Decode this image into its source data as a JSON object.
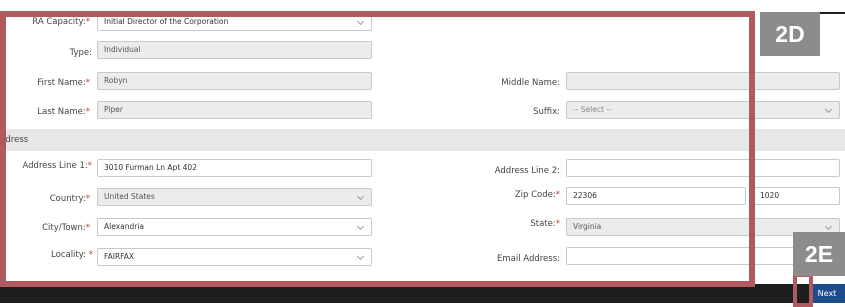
{
  "form": {
    "ra_capacity": {
      "label": "RA Capacity:",
      "required": "*",
      "value": "Initial Director of the Corporation"
    },
    "type": {
      "label": "Type:",
      "value": "Individual"
    },
    "first_name": {
      "label": "First Name:",
      "required": "*",
      "value": "Robyn"
    },
    "middle_name": {
      "label": "Middle Name:",
      "value": ""
    },
    "last_name": {
      "label": "Last Name:",
      "required": "*",
      "value": "Piper"
    },
    "suffix": {
      "label": "Suffix:",
      "value": "-- Select --"
    }
  },
  "address": {
    "section_title": "ddress",
    "line1": {
      "label": "Address Line 1:",
      "required": "*",
      "value": "3010 Furman Ln Apt 402"
    },
    "line2": {
      "label": "Address Line 2:",
      "value": ""
    },
    "country": {
      "label": "Country:",
      "required": "*",
      "value": "United States"
    },
    "zip": {
      "label": "Zip Code:",
      "required": "*",
      "value": "22306",
      "ext": "1020"
    },
    "city": {
      "label": "City/Town:",
      "required": "*",
      "value": "Alexandria"
    },
    "state": {
      "label": "State:",
      "required": "*",
      "value": "Virginia"
    },
    "locality": {
      "label": "Locality:",
      "required": " *",
      "value": "FAIRFAX"
    },
    "email": {
      "label": "Email Address:",
      "value": ""
    }
  },
  "annotations": {
    "tag_2d": "2D",
    "tag_2e": "2E",
    "highlight_color": "#b05a5f",
    "tag_color": "#8c8c8c"
  },
  "footer": {
    "next_label": "Next"
  }
}
